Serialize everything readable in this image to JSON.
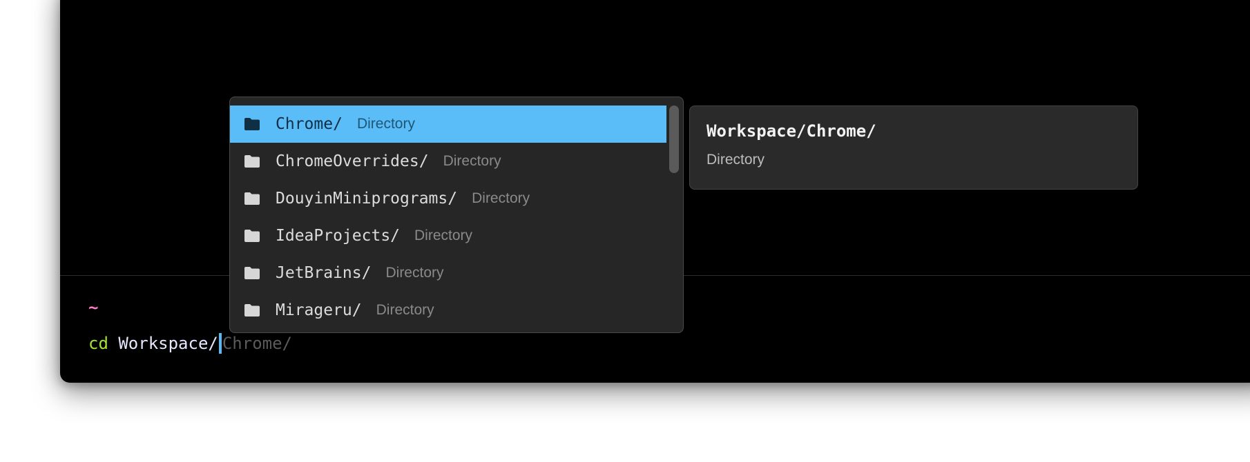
{
  "terminal": {
    "prompt_symbol": "~",
    "command": "cd",
    "argument": "Workspace/",
    "ghost_completion": "Chrome/"
  },
  "completions": {
    "items": [
      {
        "name": "Chrome/",
        "kind": "Directory",
        "icon": "folder-icon",
        "selected": true
      },
      {
        "name": "ChromeOverrides/",
        "kind": "Directory",
        "icon": "folder-icon",
        "selected": false
      },
      {
        "name": "DouyinMiniprograms/",
        "kind": "Directory",
        "icon": "folder-icon",
        "selected": false
      },
      {
        "name": "IdeaProjects/",
        "kind": "Directory",
        "icon": "folder-icon",
        "selected": false
      },
      {
        "name": "JetBrains/",
        "kind": "Directory",
        "icon": "folder-icon",
        "selected": false
      },
      {
        "name": "Mirageru/",
        "kind": "Directory",
        "icon": "folder-icon",
        "selected": false
      }
    ]
  },
  "detail": {
    "title": "Workspace/Chrome/",
    "subtitle": "Directory"
  },
  "colors": {
    "selection": "#5abdf8",
    "prompt": "#ff79c6",
    "command": "#a6e22e",
    "cursor": "#5ab8f5"
  }
}
